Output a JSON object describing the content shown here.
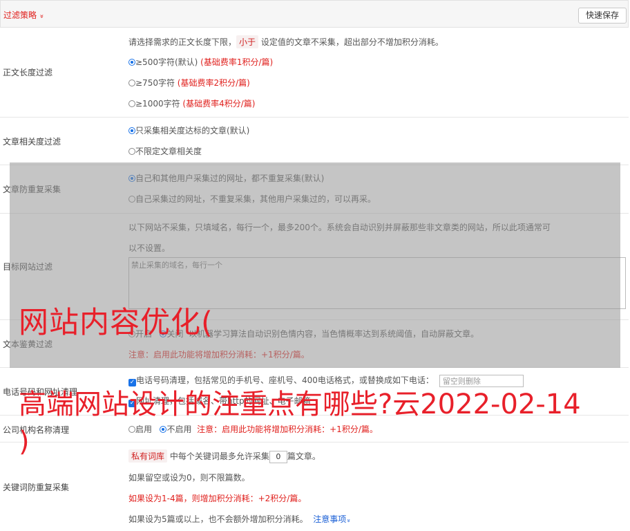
{
  "header": {
    "title": "过滤策略",
    "chevron": "»",
    "save_label": "快速保存"
  },
  "length_filter": {
    "label": "正文长度过滤",
    "desc_pre": "请选择需求的正文长度下限，",
    "desc_pill": "小于",
    "desc_post": " 设定值的文章不采集，超出部分不增加积分消耗。",
    "options": [
      {
        "text": "≥500字符(默认)",
        "note": " (基础费率1积分/篇)",
        "checked": true
      },
      {
        "text": "≥750字符",
        "note": " (基础费率2积分/篇)",
        "checked": false
      },
      {
        "text": "≥1000字符",
        "note": " (基础费率4积分/篇)",
        "checked": false
      }
    ]
  },
  "relevance_filter": {
    "label": "文章相关度过滤",
    "options": [
      {
        "text": "只采集相关度达标的文章(默认)",
        "checked": true
      },
      {
        "text": "不限定文章相关度",
        "checked": false
      }
    ]
  },
  "dedupe_filter": {
    "label": "文章防重复采集",
    "options": [
      {
        "text": "自己和其他用户采集过的网址，都不重复采集(默认)",
        "checked": true
      },
      {
        "text": "自己采集过的网址，不重复采集，其他用户采集过的，可以再采。",
        "checked": false
      }
    ]
  },
  "site_filter": {
    "label": "目标网站过滤",
    "desc1": "以下网站不采集，只填域名，每行一个，最多200个。系统会自动识别并屏蔽那些非文章类的网站，所以此项通常可",
    "desc2": "以不设置。",
    "placeholder": "禁止采集的域名，每行一个"
  },
  "porn_filter": {
    "label": "文本鉴黄过滤",
    "on_label": "开启",
    "off_label": "关闭",
    "desc": "以机器学习算法自动识别色情内容，当色情概率达到系统阈值，自动屏蔽文章。",
    "note": "注意：启用此功能将增加积分消耗：+1积分/篇。"
  },
  "contact_clean": {
    "label": "电话号码和网址清理",
    "phone_text": "电话号码清理，包括常见的手机号、座机号、400电话格式，或替换成如下电话：",
    "phone_placeholder": "留空则删除",
    "url_text": "网址清理，包括域名、带http的网址、电子邮箱"
  },
  "org_clean": {
    "label": "公司机构名称清理",
    "on_label": "启用",
    "off_label": "不启用",
    "note": "注意：启用此功能将增加积分消耗：+1积分/篇。"
  },
  "keyword_dedupe": {
    "label": "关键词防重复采集",
    "pill": "私有词库",
    "line1_mid": " 中每个关键词最多允许采集",
    "value": "0",
    "line1_post": "篇文章。",
    "line2": "如果留空或设为0，则不限篇数。",
    "line3": "如果设为1-4篇，则增加积分消耗：+2积分/篇。",
    "line4": "如果设为5篇或以上，也不会额外增加积分消耗。",
    "link": "注意事项",
    "link_chev": "»"
  },
  "watermark": {
    "line1": "网站内容优化(",
    "line2": "高端网站设计的注重点有哪些?云2022-02-14",
    "line3": ")"
  }
}
